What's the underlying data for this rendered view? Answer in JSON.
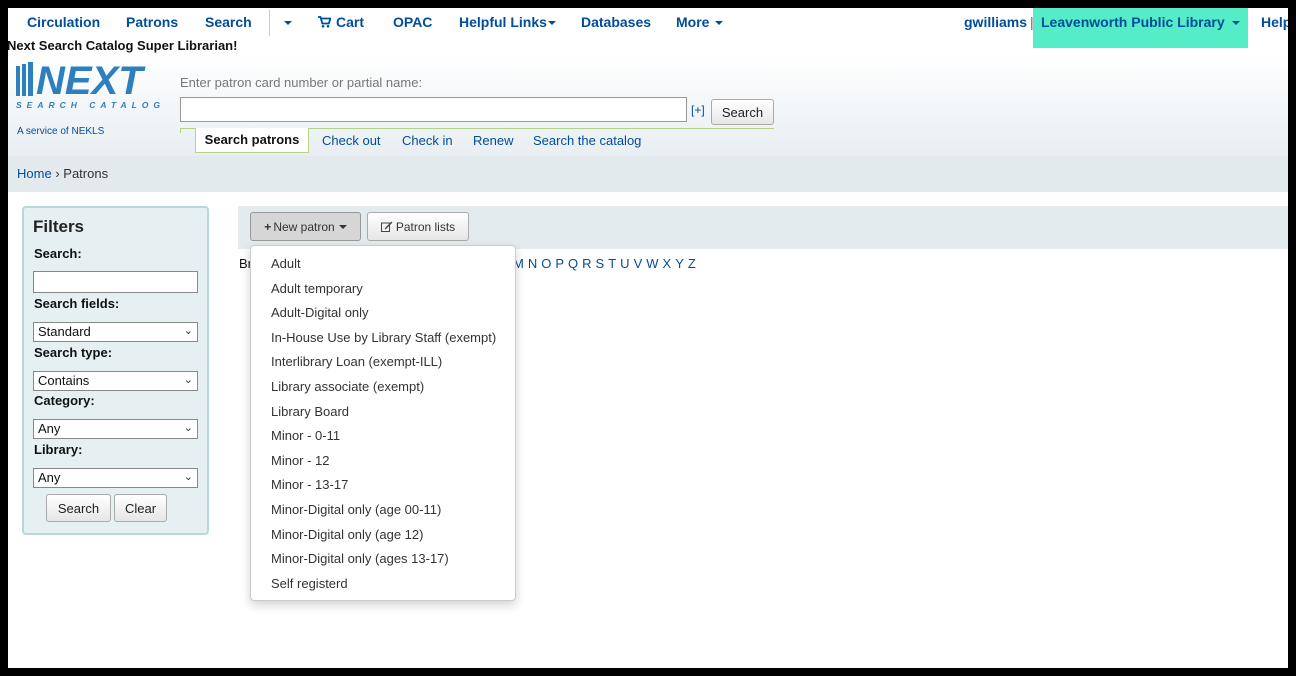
{
  "nav": {
    "circulation": "Circulation",
    "patrons": "Patrons",
    "search": "Search",
    "cart": "Cart",
    "opac": "OPAC",
    "helpful_links": "Helpful Links",
    "databases": "Databases",
    "more": "More",
    "user": "gwilliams",
    "separator": "|",
    "library": "Leavenworth Public Library",
    "help": "Help"
  },
  "greeting": "Next Search Catalog Super Librarian!",
  "logo": {
    "name": "NEXT",
    "sub": "SEARCH CATALOG",
    "service": "A service of NEKLS"
  },
  "patron_search": {
    "label": "Enter patron card number or partial name:",
    "value": "",
    "plus": "[+]",
    "button": "Search"
  },
  "tabs": {
    "active": "Search patrons",
    "items": [
      "Check out",
      "Check in",
      "Renew",
      "Search the catalog"
    ]
  },
  "breadcrumb": {
    "home": "Home",
    "sep": "›",
    "current": "Patrons"
  },
  "filters": {
    "title": "Filters",
    "search_label": "Search:",
    "search_value": "",
    "fields_label": "Search fields:",
    "fields_value": "Standard",
    "type_label": "Search type:",
    "type_value": "Contains",
    "category_label": "Category:",
    "category_value": "Any",
    "library_label": "Library:",
    "library_value": "Any",
    "search_button": "Search",
    "clear_button": "Clear"
  },
  "toolbar": {
    "new_patron": "New patron",
    "patron_lists": "Patron lists"
  },
  "browse": {
    "partial": "Br",
    "letters": [
      "M",
      "N",
      "O",
      "P",
      "Q",
      "R",
      "S",
      "T",
      "U",
      "V",
      "W",
      "X",
      "Y",
      "Z"
    ]
  },
  "new_patron_menu": [
    "Adult",
    "Adult temporary",
    "Adult-Digital only",
    "In-House Use by Library Staff (exempt)",
    "Interlibrary Loan (exempt-ILL)",
    "Library associate (exempt)",
    "Library Board",
    "Minor - 0-11",
    "Minor - 12",
    "Minor - 13-17",
    "Minor-Digital only (age 00-11)",
    "Minor-Digital only (age 12)",
    "Minor-Digital only (ages 13-17)",
    "Self registerd"
  ],
  "colors": {
    "link": "#004d99",
    "branch_highlight": "#55ecc8",
    "breadcrumb_bg": "#e2eaed",
    "filters_bg": "#e6f0f2"
  }
}
